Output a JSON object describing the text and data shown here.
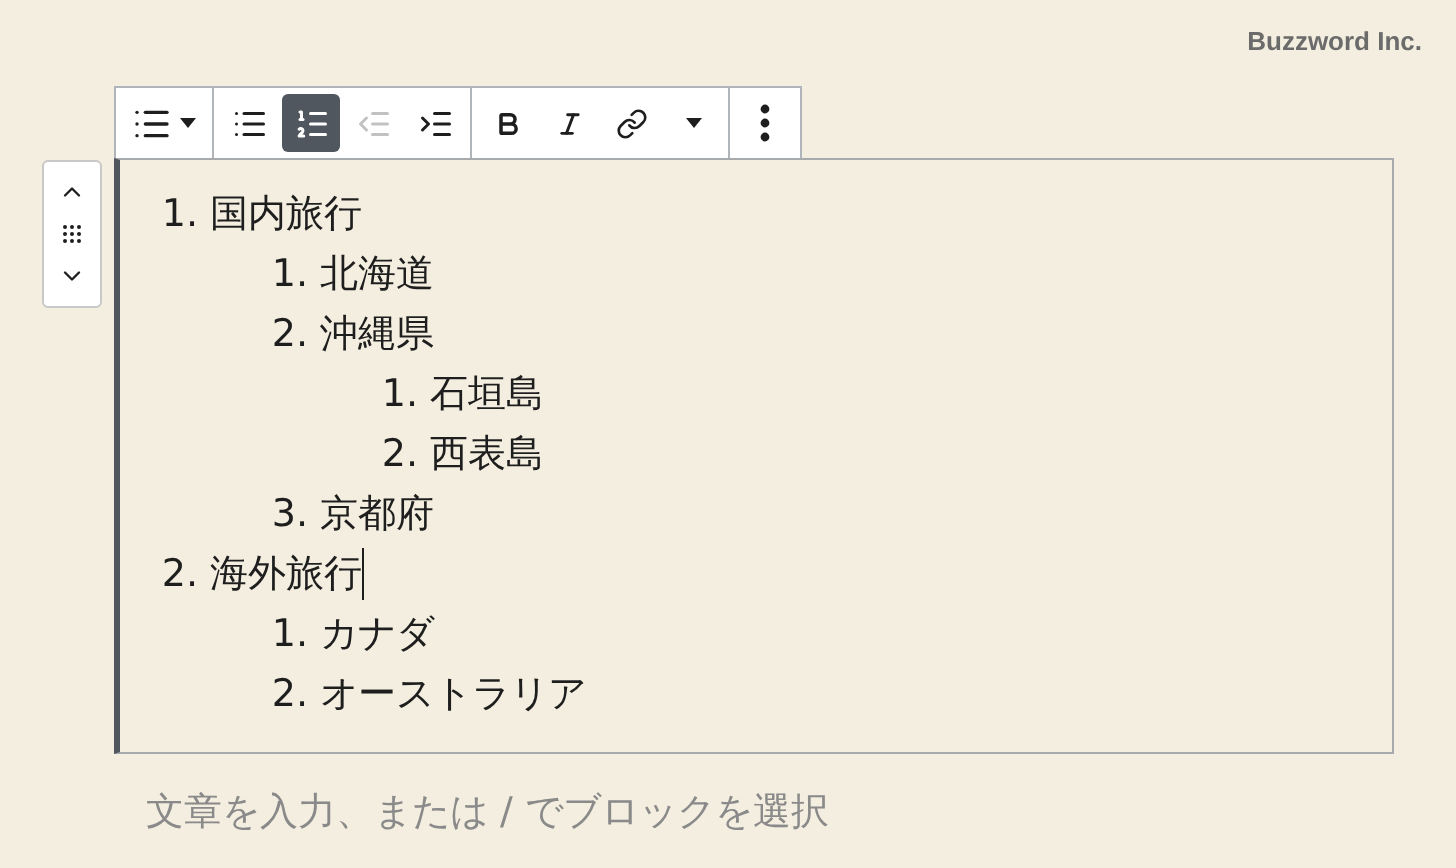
{
  "brand": "Buzzword Inc.",
  "toolbar": {
    "groups": [
      {
        "buttons": [
          {
            "kind": "list-type",
            "selected": false,
            "disabled": false
          }
        ]
      },
      {
        "buttons": [
          {
            "kind": "unordered",
            "selected": false,
            "disabled": false
          },
          {
            "kind": "ordered",
            "selected": true,
            "disabled": false
          },
          {
            "kind": "outdent",
            "selected": false,
            "disabled": true
          },
          {
            "kind": "indent",
            "selected": false,
            "disabled": false
          }
        ]
      },
      {
        "buttons": [
          {
            "kind": "bold",
            "selected": false,
            "disabled": false
          },
          {
            "kind": "italic",
            "selected": false,
            "disabled": false
          },
          {
            "kind": "link",
            "selected": false,
            "disabled": false
          },
          {
            "kind": "more",
            "selected": false,
            "disabled": false
          }
        ]
      },
      {
        "buttons": [
          {
            "kind": "options",
            "selected": false,
            "disabled": false
          }
        ]
      }
    ]
  },
  "list": {
    "items": [
      {
        "number": "1.",
        "text": "国内旅行",
        "cursor": false,
        "children": [
          {
            "number": "1.",
            "text": "北海道",
            "cursor": false
          },
          {
            "number": "2.",
            "text": "沖縄県",
            "cursor": false,
            "children": [
              {
                "number": "1.",
                "text": "石垣島",
                "cursor": false
              },
              {
                "number": "2.",
                "text": "西表島",
                "cursor": false
              }
            ]
          },
          {
            "number": "3.",
            "text": "京都府",
            "cursor": false
          }
        ]
      },
      {
        "number": "2.",
        "text": "海外旅行",
        "cursor": true,
        "children": [
          {
            "number": "1.",
            "text": "カナダ",
            "cursor": false
          },
          {
            "number": "2.",
            "text": "オーストラリア",
            "cursor": false
          }
        ]
      }
    ]
  },
  "placeholder": "文章を入力、または / でブロックを選択"
}
